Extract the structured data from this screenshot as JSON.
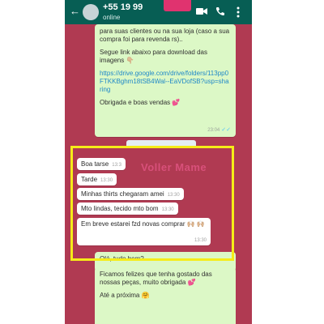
{
  "header": {
    "contact_name": "+55 19 99",
    "status": "online"
  },
  "messages": {
    "first": {
      "line1": "para suas clientes ou na sua loja (caso a sua compra foi para revenda rs)..",
      "line2": "Segue link abaixo para download das imagens 👇🏼",
      "link": "https://drive.google.com/drive/folders/113pp0FTKKBghm18tSB4Wal--EaVDofSB?usp=sharing",
      "line3": "Obrigada e boas vendas 💕",
      "time": "23:04"
    },
    "incoming": [
      {
        "text": "Boa tarse",
        "time": "13:3"
      },
      {
        "text": "Tarde",
        "time": "13:30"
      },
      {
        "text": "Minhas thirts chegaram amei",
        "time": "13:30"
      },
      {
        "text": "Mto lindas, tecido mto bom",
        "time": "13:30"
      },
      {
        "text": "Em breve estarei fzd novas comprar 🙌🏼 🙌🏼",
        "time": "13:30"
      }
    ],
    "partial_outgoing": "Olá, tudo bem?",
    "last": {
      "line1": "Ficamos felizes que tenha gostado das nossas peças, muito obrigada 💕",
      "line2": "Até a próxima 🤗"
    }
  },
  "watermark": "Voller Mame",
  "colors": {
    "header": "#075e54",
    "chat_bg": "#b03a52",
    "outgoing_bubble": "#dcf8c6",
    "highlight": "#f5ec18",
    "redaction": "#e0336f"
  }
}
